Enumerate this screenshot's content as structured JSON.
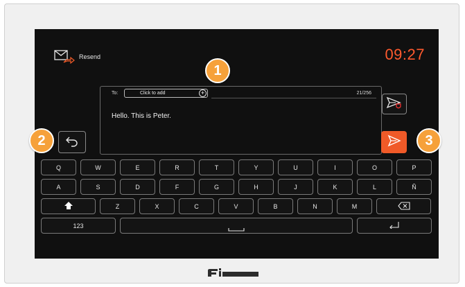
{
  "header": {
    "resend_label": "Resend",
    "clock": "09:27"
  },
  "message": {
    "to_label": "To:",
    "to_placeholder": "Click to add",
    "counter": "21/256",
    "text": "Hello. This is Peter."
  },
  "keyboard": {
    "row1": [
      "Q",
      "W",
      "E",
      "R",
      "T",
      "Y",
      "U",
      "I",
      "O",
      "P"
    ],
    "row2": [
      "A",
      "S",
      "D",
      "F",
      "G",
      "H",
      "J",
      "K",
      "L",
      "Ñ"
    ],
    "row3": [
      "Z",
      "X",
      "C",
      "V",
      "B",
      "N",
      "M"
    ],
    "numbers_label": "123"
  },
  "callouts": {
    "one": "1",
    "two": "2",
    "three": "3"
  },
  "colors": {
    "accent": "#f05a28",
    "clock": "#ff5a2e",
    "callout": "#f6a13a",
    "screen": "#101010"
  },
  "icons": [
    "envelope-forward-icon",
    "plus-icon",
    "undo-icon",
    "send-secure-icon",
    "send-icon",
    "shift-icon",
    "backspace-icon",
    "space-icon",
    "enter-icon",
    "brand-logo"
  ]
}
